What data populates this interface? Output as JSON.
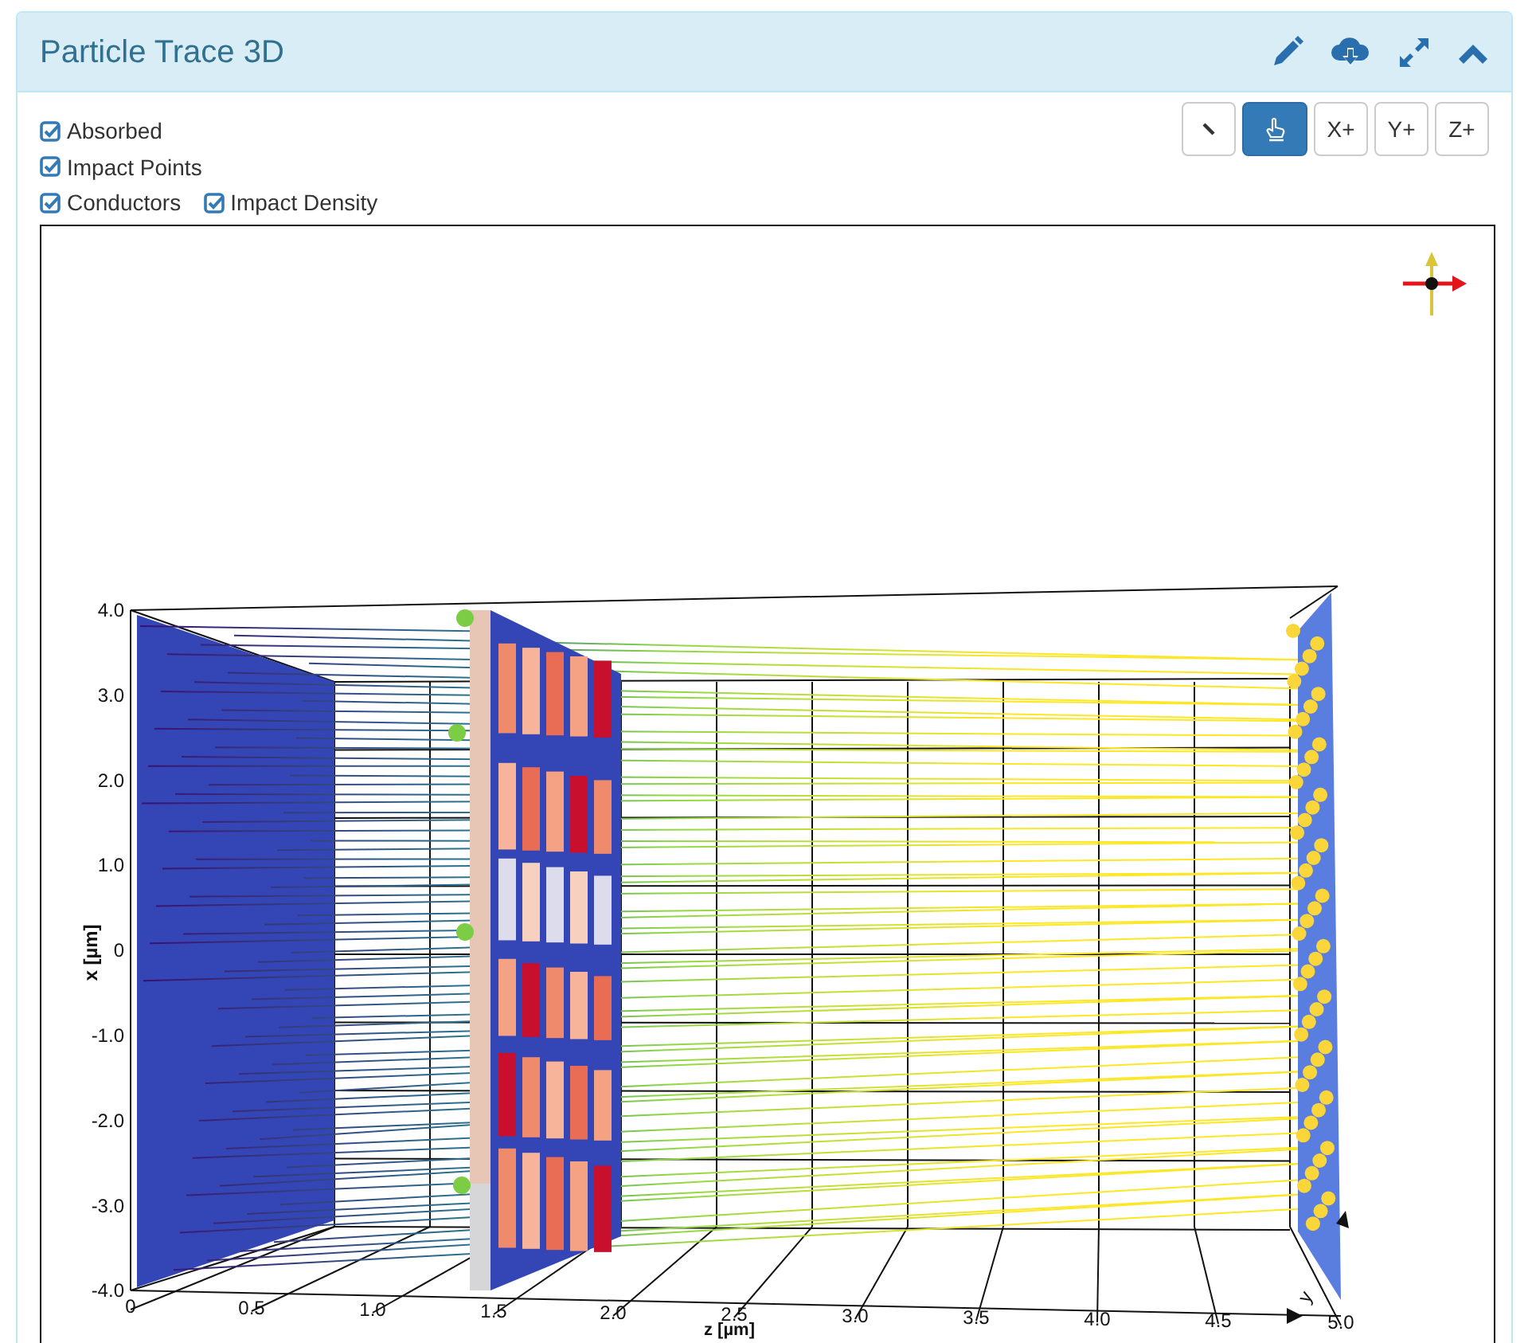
{
  "panel": {
    "title": "Particle Trace 3D"
  },
  "options": [
    {
      "items": [
        {
          "label": "Absorbed",
          "checked": true
        }
      ]
    },
    {
      "items": [
        {
          "label": "Impact Points",
          "checked": true
        }
      ]
    },
    {
      "items": [
        {
          "label": "Conductors",
          "checked": true
        },
        {
          "label": "Impact Density",
          "checked": true
        }
      ]
    }
  ],
  "toolbar": [
    {
      "kind": "pointer",
      "selected": false
    },
    {
      "kind": "hand",
      "selected": true
    },
    {
      "kind": "text",
      "label": "X+",
      "selected": false
    },
    {
      "kind": "text",
      "label": "Y+",
      "selected": false
    },
    {
      "kind": "text",
      "label": "Z+",
      "selected": false
    }
  ],
  "plot": {
    "x_axis": {
      "title": "x [µm]",
      "ticks": [
        "4.0",
        "3.0",
        "2.0",
        "1.0",
        "0",
        "-1.0",
        "-2.0",
        "-3.0",
        "-4.0"
      ]
    },
    "z_axis": {
      "title": "z [µm]",
      "ticks": [
        "0",
        "0.5",
        "1.0",
        "1.5",
        "2.0",
        "2.5",
        "3.0",
        "3.5",
        "4.0",
        "4.5",
        "5.0"
      ]
    },
    "y_axis": {
      "title": "y"
    }
  }
}
